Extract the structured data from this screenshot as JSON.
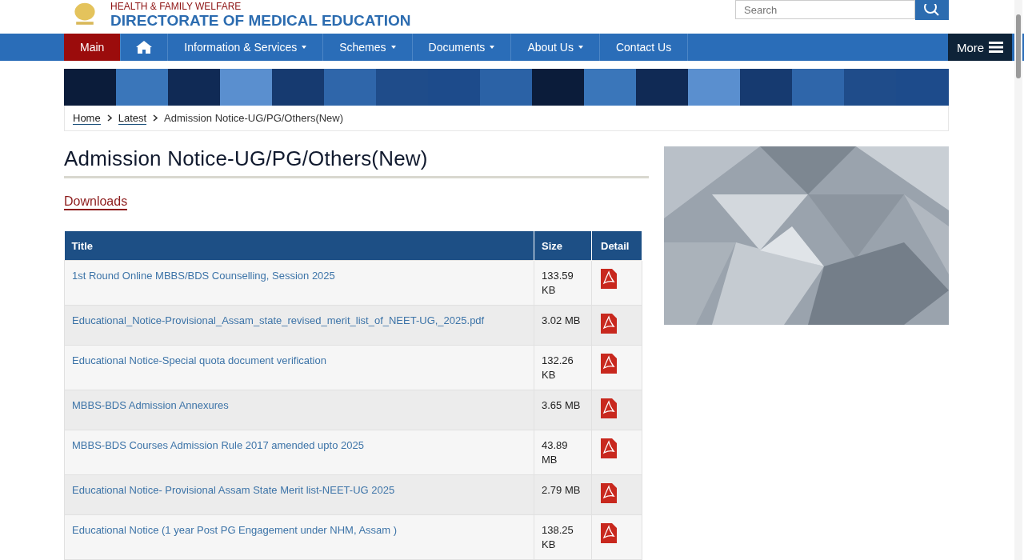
{
  "header": {
    "ministry": "HEALTH & FAMILY WELFARE",
    "title": "DIRECTORATE OF MEDICAL EDUCATION",
    "search": {
      "placeholder": "Search"
    }
  },
  "nav": {
    "items": [
      {
        "kind": "text",
        "label": "Main",
        "selected": true,
        "dropdown": false
      },
      {
        "kind": "home",
        "selected": false,
        "dropdown": false
      },
      {
        "kind": "text",
        "label": "Information & Services",
        "selected": false,
        "dropdown": true
      },
      {
        "kind": "text",
        "label": "Schemes",
        "selected": false,
        "dropdown": true
      },
      {
        "kind": "text",
        "label": "Documents",
        "selected": false,
        "dropdown": true
      },
      {
        "kind": "text",
        "label": "About Us",
        "selected": false,
        "dropdown": true
      },
      {
        "kind": "text",
        "label": "Contact Us",
        "selected": false,
        "dropdown": false
      }
    ],
    "more": "More"
  },
  "breadcrumb": {
    "links": [
      "Home",
      "Latest"
    ],
    "current": "Admission Notice-UG/PG/Others(New)"
  },
  "page_title": "Admission Notice-UG/PG/Others(New)",
  "section_link": "Downloads",
  "table": {
    "columns": [
      "Title",
      "Size",
      "Detail"
    ],
    "rows": [
      {
        "title": "1st Round Online MBBS/BDS Counselling, Session 2025",
        "size": "133.59 KB"
      },
      {
        "title": "Educational_Notice-Provisional_Assam_state_revised_merit_list_of_NEET-UG,_2025.pdf",
        "size": "3.02 MB"
      },
      {
        "title": "Educational Notice-Special quota document verification",
        "size": "132.26 KB"
      },
      {
        "title": "MBBS-BDS Admission Annexures",
        "size": "3.65 MB"
      },
      {
        "title": "MBBS-BDS Courses Admission Rule 2017 amended upto 2025",
        "size": "43.89 MB"
      },
      {
        "title": "Educational Notice- Provisional Assam State Merit list-NEET-UG 2025",
        "size": "2.79 MB"
      },
      {
        "title": "Educational Notice (1 year Post PG Engagement under NHM, Assam )",
        "size": "138.25 KB"
      }
    ]
  }
}
